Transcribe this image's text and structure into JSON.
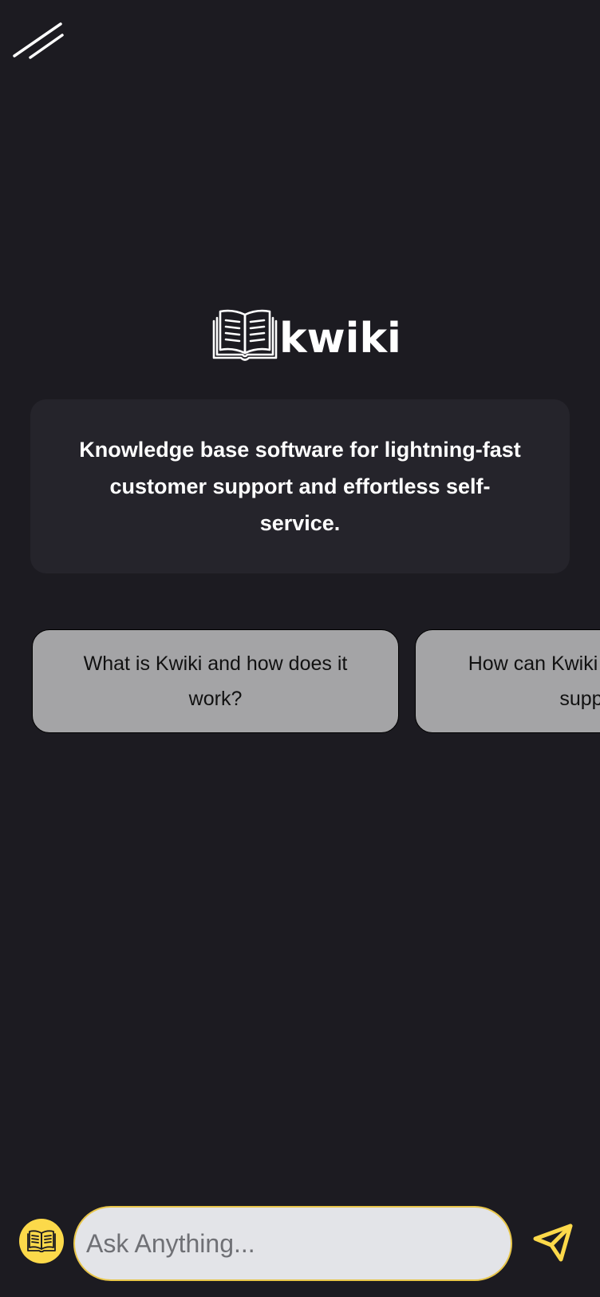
{
  "app": {
    "brand_name": "kwiki",
    "tagline": "Knowledge base software for lightning-fast customer support and effortless self-service."
  },
  "icons": {
    "menu": "menu-slash-icon",
    "logo": "open-book-icon",
    "knowledge_base": "open-book-icon",
    "send": "paper-plane-icon"
  },
  "suggestions": [
    {
      "label": "What is Kwiki and how does it work?"
    },
    {
      "label": "How can Kwiki help customer support?"
    }
  ],
  "composer": {
    "placeholder": "Ask Anything...",
    "value": ""
  },
  "colors": {
    "background": "#1c1b21",
    "card": "#25242b",
    "suggestion": "#a4a4a6",
    "accent": "#fcd94a",
    "input": "#e3e4e8"
  }
}
